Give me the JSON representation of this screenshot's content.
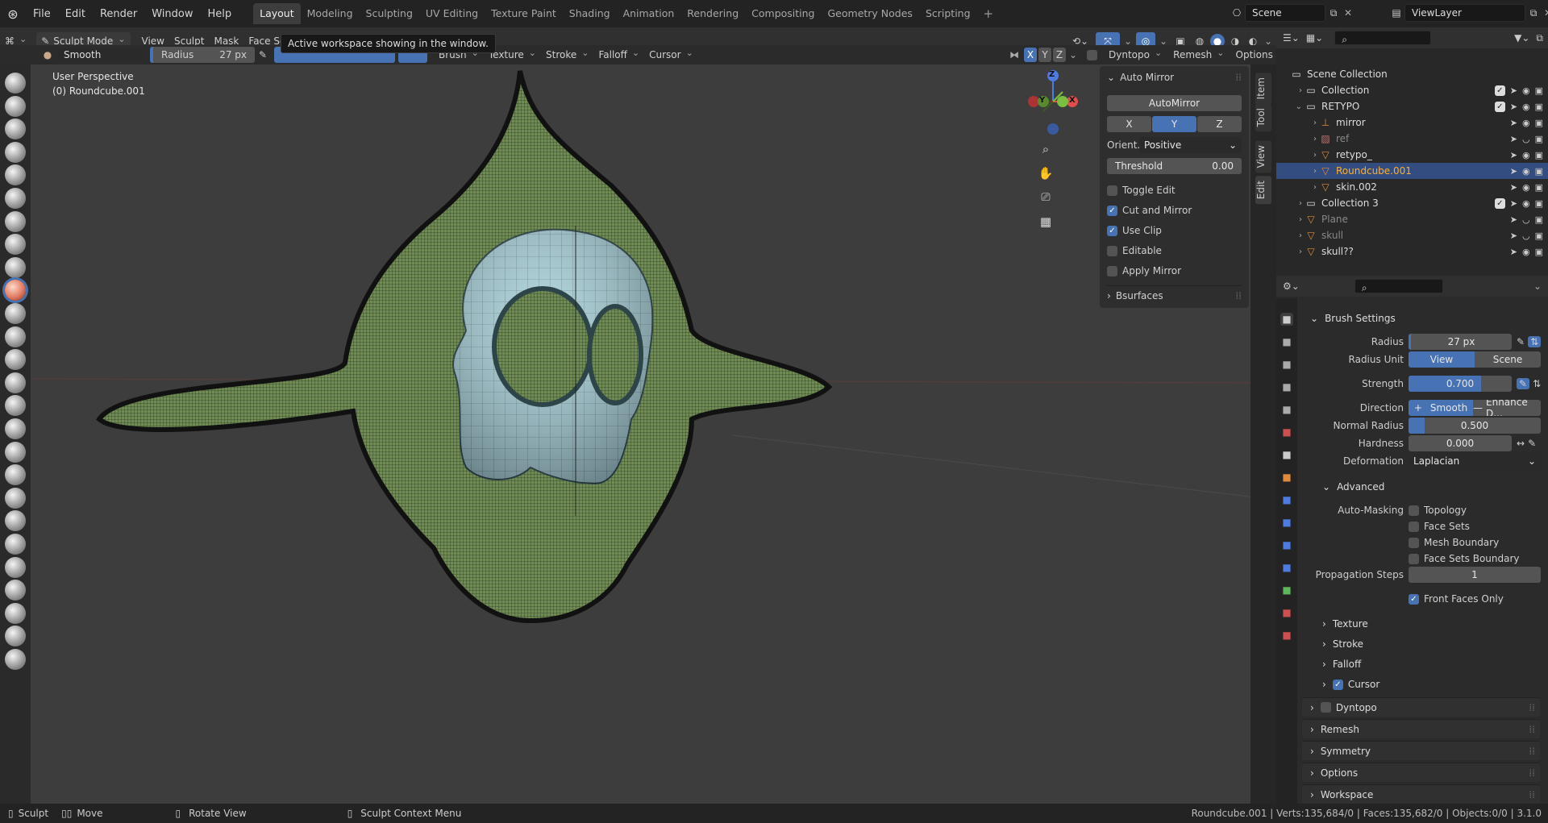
{
  "menu": [
    "File",
    "Edit",
    "Render",
    "Window",
    "Help"
  ],
  "workspaces": [
    "Layout",
    "Modeling",
    "Sculpting",
    "UV Editing",
    "Texture Paint",
    "Shading",
    "Animation",
    "Rendering",
    "Compositing",
    "Geometry Nodes",
    "Scripting"
  ],
  "active_workspace": "Layout",
  "scene": "Scene",
  "view_layer": "ViewLayer",
  "tooltip": "Active workspace showing in the window.",
  "viewport_header": {
    "mode": "Sculpt Mode",
    "menus": [
      "View",
      "Sculpt",
      "Mask",
      "Face Sets"
    ],
    "brush_name": "Smooth",
    "radius_label": "Radius",
    "radius_value": "27 px",
    "dropdowns": [
      "Brush",
      "Texture",
      "Stroke",
      "Falloff",
      "Cursor"
    ],
    "axes": [
      "X",
      "Y",
      "Z"
    ],
    "right_dropdowns": [
      "Dyntopo",
      "Remesh",
      "Options"
    ]
  },
  "viewport": {
    "perspective": "User Perspective",
    "object": "(0) Roundcube.001",
    "gizmo": {
      "z": "Z",
      "y": "Y",
      "x": "X"
    }
  },
  "npanel": {
    "title": "Auto Mirror",
    "automirror_button": "AutoMirror",
    "axes": [
      "X",
      "Y",
      "Z"
    ],
    "active_axis": "Y",
    "orient_label": "Orient...",
    "orient_value": "Positive",
    "threshold_label": "Threshold",
    "threshold_value": "0.00",
    "checks": [
      {
        "label": "Toggle Edit",
        "on": false
      },
      {
        "label": "Cut and Mirror",
        "on": true
      },
      {
        "label": "Use Clip",
        "on": true
      },
      {
        "label": "Editable",
        "on": false
      },
      {
        "label": "Apply Mirror",
        "on": false
      }
    ],
    "bsurfaces": "Bsurfaces",
    "tabs": [
      "Item",
      "Tool",
      "View",
      "Edit"
    ]
  },
  "outliner": {
    "rows": [
      {
        "label": "Scene Collection",
        "indent": 0,
        "type": "collection",
        "sel": false
      },
      {
        "label": "Collection",
        "indent": 1,
        "type": "collection",
        "sel": false
      },
      {
        "label": "RETYPO",
        "indent": 1,
        "type": "collection",
        "sel": false
      },
      {
        "label": "mirror",
        "indent": 2,
        "type": "empty",
        "sel": false
      },
      {
        "label": "ref",
        "indent": 2,
        "type": "image",
        "sel": false
      },
      {
        "label": "retypo_",
        "indent": 2,
        "type": "mesh",
        "sel": false
      },
      {
        "label": "Roundcube.001",
        "indent": 2,
        "type": "mesh",
        "sel": true
      },
      {
        "label": "skin.002",
        "indent": 2,
        "type": "mesh",
        "sel": false
      },
      {
        "label": "Collection 3",
        "indent": 1,
        "type": "collection",
        "sel": false
      },
      {
        "label": "Plane",
        "indent": 1,
        "type": "mesh",
        "sel": false
      },
      {
        "label": "skull",
        "indent": 1,
        "type": "mesh",
        "sel": false
      },
      {
        "label": "skull??",
        "indent": 1,
        "type": "mesh",
        "sel": false
      }
    ]
  },
  "properties": {
    "brush_settings": "Brush Settings",
    "radius_label": "Radius",
    "radius_value": "27 px",
    "radius_unit_label": "Radius Unit",
    "radius_unit_view": "View",
    "radius_unit_scene": "Scene",
    "strength_label": "Strength",
    "strength_value": "0.700",
    "strength_fraction": 0.7,
    "direction_label": "Direction",
    "direction_smooth": "Smooth",
    "direction_enhance": "Enhance D...",
    "normal_radius_label": "Normal Radius",
    "normal_radius_value": "0.500",
    "normal_radius_fraction": 0.5,
    "hardness_label": "Hardness",
    "hardness_value": "0.000",
    "deformation_label": "Deformation",
    "deformation_value": "Laplacian",
    "advanced": "Advanced",
    "automasking_label": "Auto-Masking",
    "automasking": [
      "Topology",
      "Face Sets",
      "Mesh Boundary",
      "Face Sets Boundary"
    ],
    "propagation_label": "Propagation Steps",
    "propagation_value": "1",
    "front_faces": "Front Faces Only",
    "subsections": [
      "Texture",
      "Stroke",
      "Falloff",
      "Cursor"
    ],
    "panels": [
      "Dyntopo",
      "Remesh",
      "Symmetry",
      "Options",
      "Workspace"
    ]
  },
  "status": {
    "sculpt": "Sculpt",
    "move": "Move",
    "rotate": "Rotate View",
    "context": "Sculpt Context Menu",
    "stats": "Roundcube.001 | Verts:135,684/0 | Faces:135,682/0 | Objects:0/0 | 3.1.0"
  },
  "colors": {
    "accent": "#4772b3",
    "selected_text": "#ffaf29",
    "mesh_green": "#7a9a5a",
    "skull_blue": "#9ec8d2"
  }
}
